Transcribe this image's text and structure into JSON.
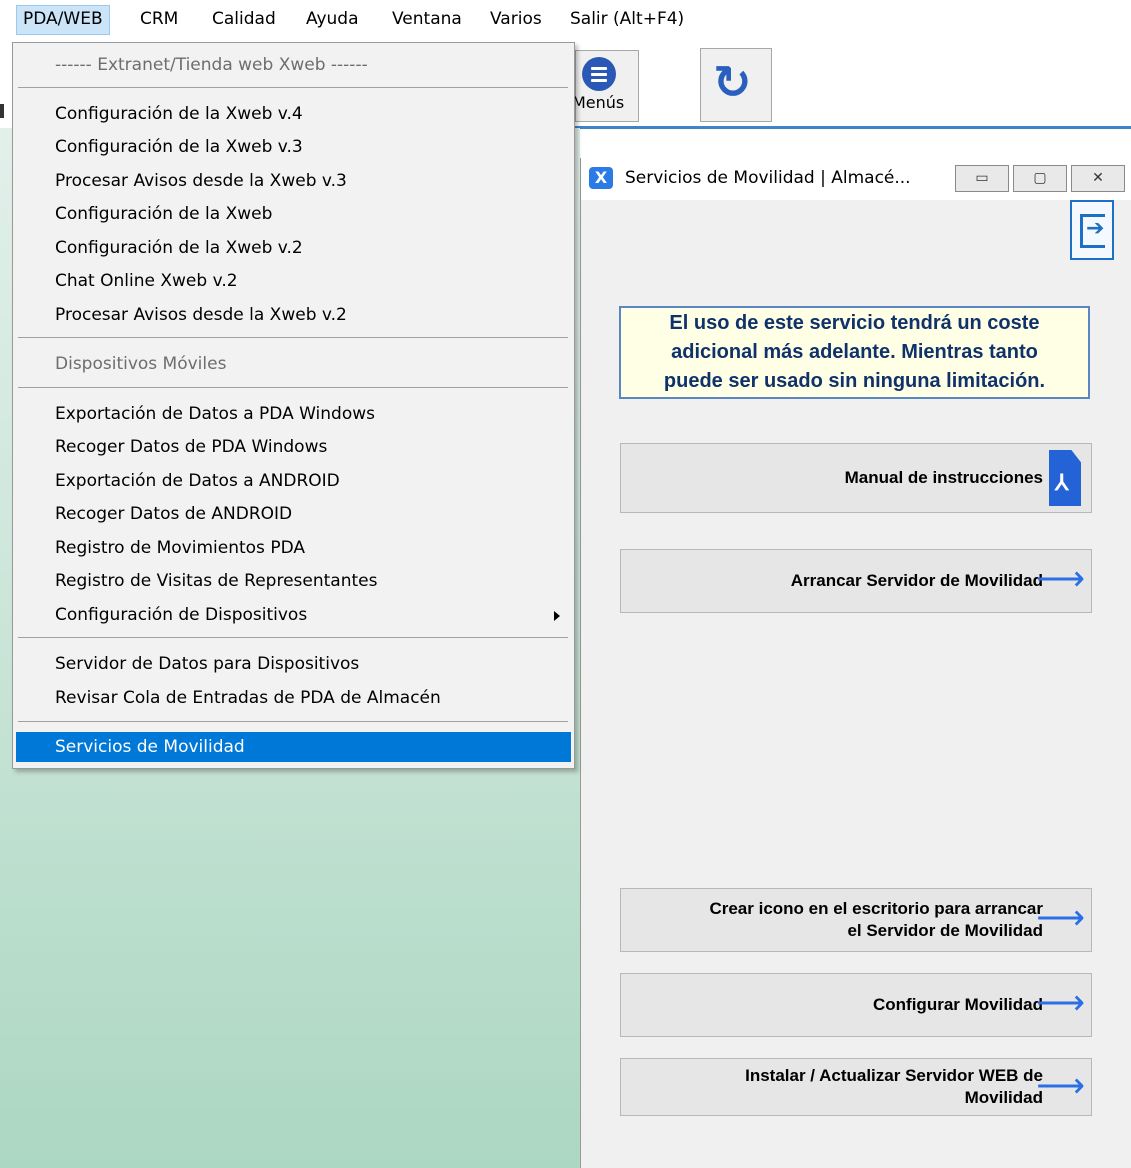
{
  "menubar": {
    "items": [
      "PDA/WEB",
      "CRM",
      "Calidad",
      "Ayuda",
      "Ventana",
      "Varios",
      "Salir (Alt+F4)"
    ]
  },
  "toolbar": {
    "menus_label": "Menús",
    "refresh_glyph": "↻"
  },
  "dropdown": {
    "header": "------ Extranet/Tienda web Xweb ------",
    "group1": [
      "Configuración de la Xweb v.4",
      "Configuración de la Xweb v.3",
      "Procesar Avisos desde la Xweb v.3",
      "Configuración de la Xweb",
      "Configuración de la Xweb v.2",
      "Chat Online Xweb v.2",
      "Procesar Avisos desde la Xweb v.2"
    ],
    "section2_header": "Dispositivos Móviles",
    "group2": [
      "Exportación de Datos a PDA Windows",
      "Recoger Datos de PDA Windows",
      "Exportación de Datos a ANDROID",
      "Recoger Datos de ANDROID",
      "Registro de Movimientos PDA",
      "Registro de Visitas de Representantes",
      "Configuración de Dispositivos"
    ],
    "group3": [
      "Servidor de Datos para Dispositivos",
      "Revisar Cola de Entradas de PDA de Almacén"
    ],
    "selected": "Servicios de Movilidad"
  },
  "window": {
    "title": "Servicios de Movilidad  | Almacé...",
    "icon_letter": "X",
    "controls": {
      "minimize": "▭",
      "maximize": "▢",
      "close": "✕"
    },
    "notice": [
      "El uso de este servicio tendrá un coste",
      "adicional más adelante. Mientras tanto",
      "puede ser usado sin ninguna limitación."
    ],
    "buttons": {
      "manual": "Manual de instrucciones",
      "arrancar": "Arrancar Servidor de Movilidad",
      "crear_icono_1": "Crear icono en el escritorio para arrancar",
      "crear_icono_2": "el Servidor de Movilidad",
      "configurar": "Configurar Movilidad",
      "instalar_1": "Instalar / Actualizar Servidor WEB de",
      "instalar_2": "Movilidad"
    },
    "arrow_glyph": "⟶"
  },
  "colors": {
    "accent": "#0078d7",
    "notice_bg": "#ffffe6",
    "notice_text": "#10326a",
    "arrow": "#2a6fe6",
    "background_green": "#acd7c2"
  }
}
